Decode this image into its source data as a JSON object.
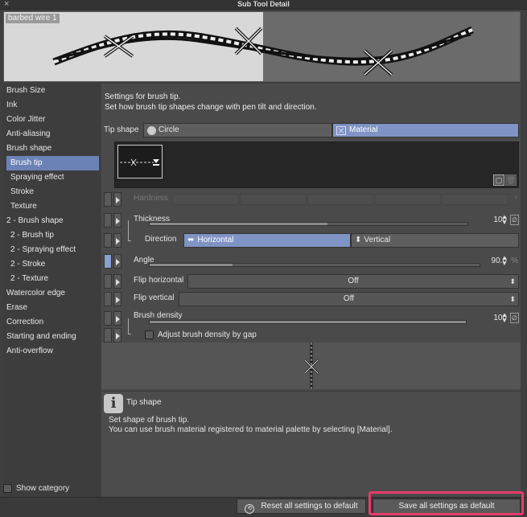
{
  "window": {
    "title": "Sub Tool Detail",
    "close_glyph": "×"
  },
  "preview": {
    "name": "barbed wire 1"
  },
  "sidebar": {
    "items": [
      {
        "label": "Brush Size",
        "sub": false,
        "selected": false
      },
      {
        "label": "Ink",
        "sub": false,
        "selected": false
      },
      {
        "label": "Color Jitter",
        "sub": false,
        "selected": false
      },
      {
        "label": "Anti-aliasing",
        "sub": false,
        "selected": false
      },
      {
        "label": "Brush shape",
        "sub": false,
        "selected": false
      },
      {
        "label": "Brush tip",
        "sub": true,
        "selected": true
      },
      {
        "label": "Spraying effect",
        "sub": true,
        "selected": false
      },
      {
        "label": "Stroke",
        "sub": true,
        "selected": false
      },
      {
        "label": "Texture",
        "sub": true,
        "selected": false
      },
      {
        "label": "2 - Brush shape",
        "sub": false,
        "selected": false
      },
      {
        "label": "2 - Brush tip",
        "sub": true,
        "selected": false
      },
      {
        "label": "2 - Spraying effect",
        "sub": true,
        "selected": false
      },
      {
        "label": "2 - Stroke",
        "sub": true,
        "selected": false
      },
      {
        "label": "2 - Texture",
        "sub": true,
        "selected": false
      },
      {
        "label": "Watercolor edge",
        "sub": false,
        "selected": false
      },
      {
        "label": "Erase",
        "sub": false,
        "selected": false
      },
      {
        "label": "Correction",
        "sub": false,
        "selected": false
      },
      {
        "label": "Starting and ending",
        "sub": false,
        "selected": false
      },
      {
        "label": "Anti-overflow",
        "sub": false,
        "selected": false
      }
    ],
    "show_category": "Show category"
  },
  "main": {
    "desc_line1": "Settings for brush tip.",
    "desc_line2": "Set how brush tip shapes change with pen tilt and direction.",
    "tip_shape": {
      "label": "Tip shape",
      "option_circle": "Circle",
      "option_material": "Material",
      "selected": "Material"
    },
    "hardness": {
      "label": "Hardness"
    },
    "thickness": {
      "label": "Thickness",
      "value": "100",
      "level": 0.56
    },
    "direction": {
      "label": "Direction",
      "option_horizontal": "Horizontal",
      "option_vertical": "Vertical",
      "selected": "Horizontal"
    },
    "angle": {
      "label": "Angle",
      "value": "90.0",
      "unit": "%",
      "level": 0.25
    },
    "flip_horizontal": {
      "label": "Flip horizontal",
      "value": "Off"
    },
    "flip_vertical": {
      "label": "Flip vertical",
      "value": "Off"
    },
    "brush_density": {
      "label": "Brush density",
      "value": "100",
      "level": 1.0
    },
    "adjust_density": {
      "label": "Adjust brush density by gap"
    },
    "info": {
      "title": "Tip shape",
      "line1": "Set shape of brush tip.",
      "line2": "You can use brush material registered to material palette by selecting [Material]."
    }
  },
  "footer": {
    "reset_label": "Reset all settings to default",
    "save_label": "Save all settings as default"
  },
  "colors": {
    "accent": "#7f93c4",
    "selection": "#6b82b6",
    "highlight": "#e83a6a"
  }
}
